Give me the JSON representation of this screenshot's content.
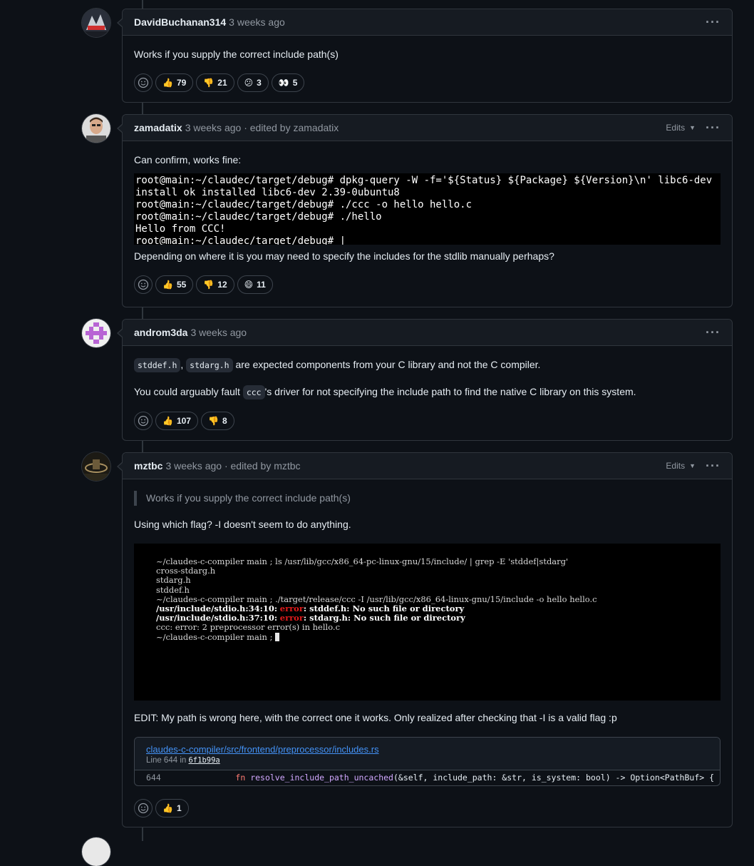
{
  "comments": [
    {
      "author": "DavidBuchanan314",
      "meta": "3 weeks ago",
      "body": [
        "Works if you supply the correct include path(s)"
      ],
      "reactions": [
        {
          "emoji": "👍",
          "count": "79"
        },
        {
          "emoji": "👎",
          "count": "21"
        },
        {
          "emoji": "😕",
          "count": "3"
        },
        {
          "emoji": "👀",
          "count": "5"
        }
      ]
    },
    {
      "author": "zamadatix",
      "meta": "3 weeks ago · edited by zamadatix",
      "edits_label": "Edits",
      "body_intro": "Can confirm, works fine:",
      "terminal": [
        "root@main:~/claudec/target/debug# dpkg-query -W -f='${Status} ${Package} ${Version}\\n' libc6-dev",
        "install ok installed libc6-dev 2.39-0ubuntu8",
        "root@main:~/claudec/target/debug# ./ccc -o hello hello.c",
        "root@main:~/claudec/target/debug# ./hello",
        "Hello from CCC!",
        "root@main:~/claudec/target/debug# |"
      ],
      "body_outro": "Depending on where it is you may need to specify the includes for the stdlib manually perhaps?",
      "reactions": [
        {
          "emoji": "👍",
          "count": "55"
        },
        {
          "emoji": "👎",
          "count": "12"
        },
        {
          "emoji": "😄",
          "count": "11"
        }
      ]
    },
    {
      "author": "androm3da",
      "meta": "3 weeks ago",
      "p1_code1": "stddef.h",
      "p1_sep": ",",
      "p1_code2": "stdarg.h",
      "p1_text": "are expected components from your C library and not the C compiler.",
      "p2_pre": "You could arguably fault",
      "p2_code": "ccc",
      "p2_post": "'s driver for not specifying the include path to find the native C library on this system.",
      "reactions": [
        {
          "emoji": "👍",
          "count": "107"
        },
        {
          "emoji": "👎",
          "count": "8"
        }
      ]
    },
    {
      "author": "mztbc",
      "meta": "3 weeks ago · edited by mztbc",
      "edits_label": "Edits",
      "quote": "Works if you supply the correct include path(s)",
      "question": "Using which flag? -I doesn't seem to do anything.",
      "terminal": {
        "l1": "~/claudes-c-compiler main ; ls /usr/lib/gcc/x86_64-pc-linux-gnu/15/include/ | grep -E 'stddef|stdarg'",
        "l2": "cross-stdarg.h",
        "l3": "stdarg.h",
        "l4": "stddef.h",
        "l5": "~/claudes-c-compiler main ; ./target/release/ccc -I /usr/lib/gcc/x86_64-linux-gnu/15/include -o hello hello.c",
        "l6_loc": "/usr/include/stdio.h:34:10:",
        "l6_err": "error",
        "l6_msg": ": stddef.h: No such file or directory",
        "l7_loc": "/usr/include/stdio.h:37:10:",
        "l7_err": "error",
        "l7_msg": ": stdarg.h: No such file or directory",
        "l8": "ccc: error: 2 preprocessor error(s) in hello.c",
        "l9": "~/claudes-c-compiler main ; "
      },
      "edit_note": "EDIT: My path is wrong here, with the correct one it works. Only realized after checking that -I is a valid flag :p",
      "snippet": {
        "path": "claudes-c-compiler/src/frontend/preprocessor/includes.rs",
        "line_label": "Line 644 in",
        "sha": "6f1b99a",
        "line_no": "644",
        "kw": "fn",
        "fn_name": "resolve_include_path_uncached",
        "rest": "(&self, include_path: &str, is_system: bool) -> Option<PathBuf> {"
      },
      "reactions": [
        {
          "emoji": "👍",
          "count": "1"
        }
      ]
    }
  ],
  "kebab": "···"
}
